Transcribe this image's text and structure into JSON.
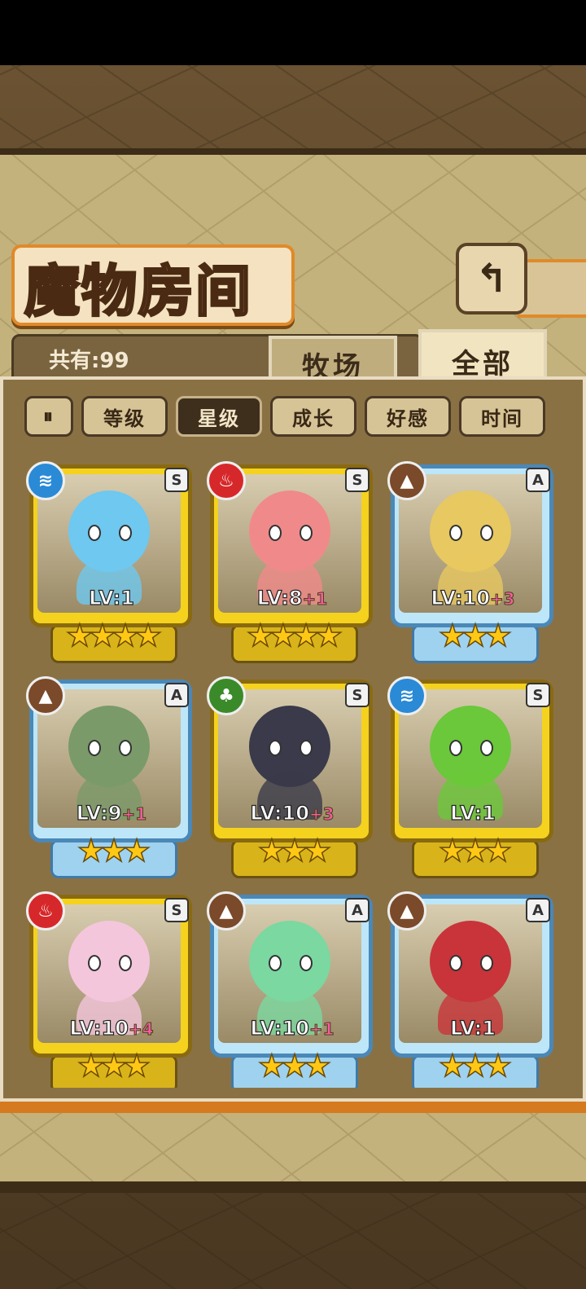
{
  "header": {
    "title": "魔物房间",
    "back_icon": "back-arrow-icon"
  },
  "summary": {
    "count_label": "共有:99"
  },
  "tabs": [
    {
      "label": "牧场",
      "active": false
    },
    {
      "label": "全部",
      "active": true
    }
  ],
  "sort": {
    "toggle_icon": "pause-sort-icon",
    "buttons": [
      {
        "label": "等级",
        "active": false
      },
      {
        "label": "星级",
        "active": true
      },
      {
        "label": "成长",
        "active": false
      },
      {
        "label": "好感",
        "active": false
      },
      {
        "label": "时间",
        "active": false
      }
    ]
  },
  "monsters": [
    {
      "rank": "S",
      "element": "water",
      "lv": "LV:1",
      "plus": "",
      "stars": "★★★★",
      "frame": "gold",
      "color": "#6ec8f0"
    },
    {
      "rank": "S",
      "element": "fire",
      "lv": "LV:8",
      "plus": "+1",
      "stars": "★★★★",
      "frame": "gold",
      "color": "#f08a8a"
    },
    {
      "rank": "A",
      "element": "earth",
      "lv": "LV:10",
      "plus": "+3",
      "stars": "★★★",
      "frame": "blue",
      "color": "#e8c860"
    },
    {
      "rank": "A",
      "element": "earth",
      "lv": "LV:9",
      "plus": "+1",
      "stars": "★★★",
      "frame": "blue",
      "color": "#7a9a6a"
    },
    {
      "rank": "S",
      "element": "wood",
      "lv": "LV:10",
      "plus": "+3",
      "stars": "★★★",
      "frame": "gold",
      "color": "#3a3a4a"
    },
    {
      "rank": "S",
      "element": "water",
      "lv": "LV:1",
      "plus": "",
      "stars": "★★★",
      "frame": "gold",
      "color": "#6ac83a"
    },
    {
      "rank": "S",
      "element": "fire",
      "lv": "LV:10",
      "plus": "+4",
      "stars": "★★★",
      "frame": "gold",
      "color": "#f4c6dc"
    },
    {
      "rank": "A",
      "element": "earth",
      "lv": "LV:10",
      "plus": "+1",
      "stars": "★★★",
      "frame": "blue",
      "color": "#7ad8a0"
    },
    {
      "rank": "A",
      "element": "earth",
      "lv": "LV:1",
      "plus": "",
      "stars": "★★★",
      "frame": "blue",
      "color": "#c8343a"
    }
  ],
  "colors": {
    "accent": "#e08a2a",
    "gold_frame": "#f4d21e",
    "blue_frame": "#bde6f8"
  }
}
